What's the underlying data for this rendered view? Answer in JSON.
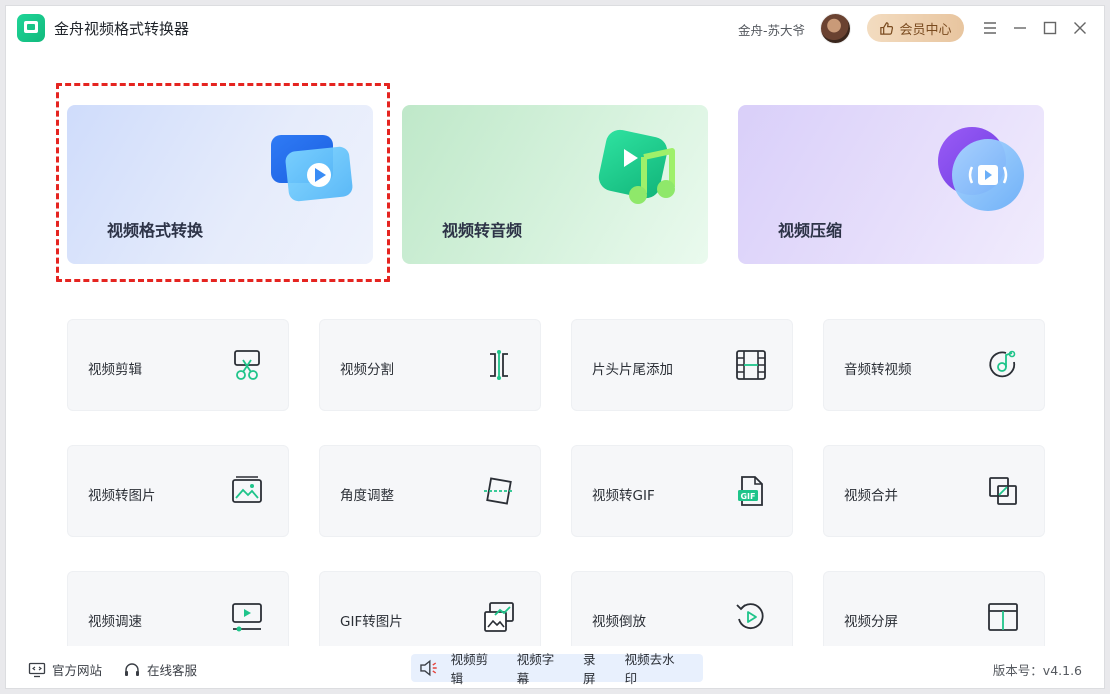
{
  "app": {
    "title": "金舟视频格式转换器"
  },
  "header": {
    "user_name": "金舟-苏大爷",
    "vip_label": "会员中心"
  },
  "features": [
    {
      "label": "视频格式转换",
      "icon": "video-convert-icon"
    },
    {
      "label": "视频转音频",
      "icon": "music-note-icon"
    },
    {
      "label": "视频压缩",
      "icon": "compress-icon"
    }
  ],
  "tools": [
    {
      "label": "视频剪辑",
      "icon": "scissors-icon"
    },
    {
      "label": "视频分割",
      "icon": "split-icon"
    },
    {
      "label": "片头片尾添加",
      "icon": "film-strip-icon"
    },
    {
      "label": "音频转视频",
      "icon": "music-disc-icon"
    },
    {
      "label": "视频转图片",
      "icon": "image-icon"
    },
    {
      "label": "角度调整",
      "icon": "rotate-frame-icon"
    },
    {
      "label": "视频转GIF",
      "icon": "gif-file-icon"
    },
    {
      "label": "视频合并",
      "icon": "merge-icon"
    },
    {
      "label": "视频调速",
      "icon": "speed-icon"
    },
    {
      "label": "GIF转图片",
      "icon": "gif-image-icon"
    },
    {
      "label": "视频倒放",
      "icon": "reverse-play-icon"
    },
    {
      "label": "视频分屏",
      "icon": "split-screen-icon"
    }
  ],
  "footer": {
    "website_label": "官方网站",
    "service_label": "在线客服",
    "promo": [
      "视频剪辑",
      "视频字幕",
      "录屏",
      "视频去水印"
    ],
    "version": "版本号：v4.1.6"
  },
  "colors": {
    "accent": "#1fc48a",
    "highlight": "#e52420",
    "vip": "#e8c59f"
  }
}
